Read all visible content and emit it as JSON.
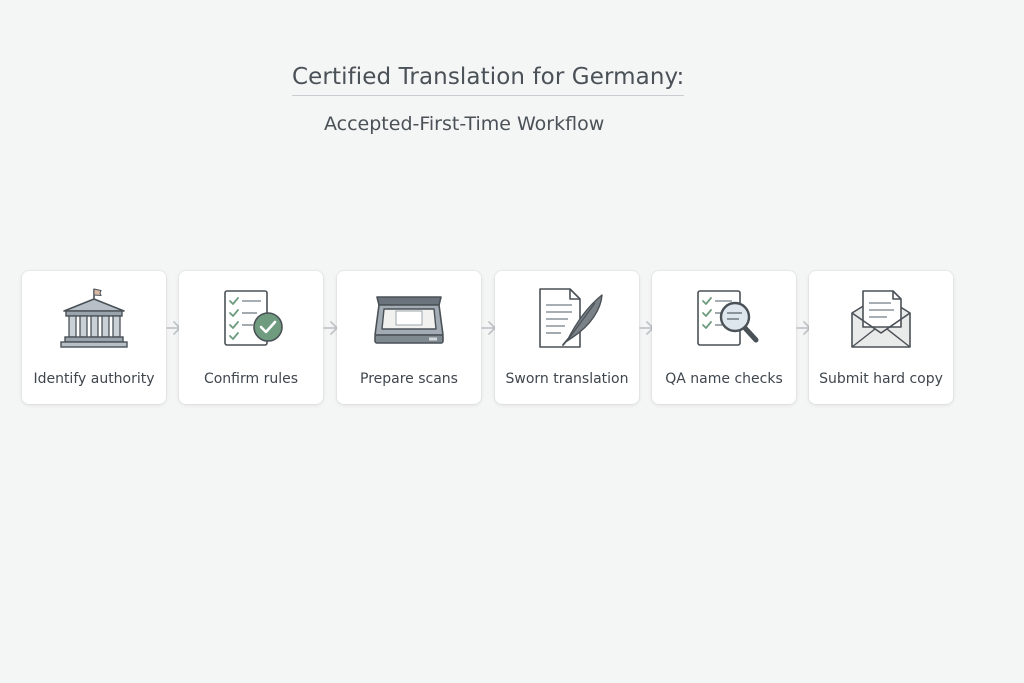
{
  "title": "Certified Translation for Germany:",
  "subtitle": "Accepted-First-Time Workflow",
  "steps": [
    {
      "label": "Identify authority",
      "icon": "government-building-icon"
    },
    {
      "label": "Confirm rules",
      "icon": "checklist-approved-icon"
    },
    {
      "label": "Prepare scans",
      "icon": "scanner-icon"
    },
    {
      "label": "Sworn translation",
      "icon": "document-quill-icon"
    },
    {
      "label": "QA name checks",
      "icon": "checklist-magnifier-icon"
    },
    {
      "label": "Submit hard copy",
      "icon": "envelope-letter-icon"
    }
  ],
  "colors": {
    "background": "#f4f5f5",
    "card": "#ffffff",
    "icon_gray": "#8a949c",
    "icon_dark": "#4a5157",
    "check_green": "#6f9c7e",
    "arrow": "#c2c6ca",
    "flag": "#d9b9a6"
  }
}
